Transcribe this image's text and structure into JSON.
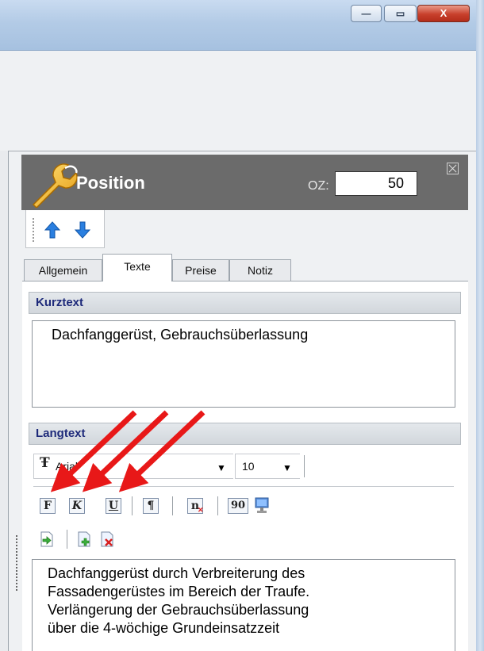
{
  "window": {
    "minimize_symbol": "—",
    "maximize_symbol": "▭",
    "close_symbol": "X"
  },
  "panel": {
    "title": "Position",
    "oz_label": "OZ:",
    "oz_value": "50",
    "icon": "wrench-icon",
    "header_color": "#6b6b6b"
  },
  "nav": {
    "up_icon": "arrow-up-icon",
    "down_icon": "arrow-down-icon"
  },
  "tabs": [
    {
      "label": "Allgemein",
      "active": false
    },
    {
      "label": "Texte",
      "active": true
    },
    {
      "label": "Preise",
      "active": false
    },
    {
      "label": "Notiz",
      "active": false
    }
  ],
  "kurztext": {
    "header": "Kurztext",
    "value": "Dachfanggerüst, Gebrauchsüberlassung"
  },
  "langtext": {
    "header": "Langtext",
    "font_name": "Arial",
    "font_size": "10",
    "format_buttons": {
      "bold": "F",
      "italic": "K",
      "underline": "U",
      "pilcrow": "¶",
      "clear_format": "n",
      "ninety": "90"
    },
    "lines": [
      "Dachfanggerüst durch Verbreiterung des",
      "Fassadengerüstes im Bereich der Traufe.",
      "Verlängerung der Gebrauchsüberlassung",
      "über die 4-wöchige Grundeinsatzzeit"
    ]
  },
  "annotation_color": "#e81818"
}
